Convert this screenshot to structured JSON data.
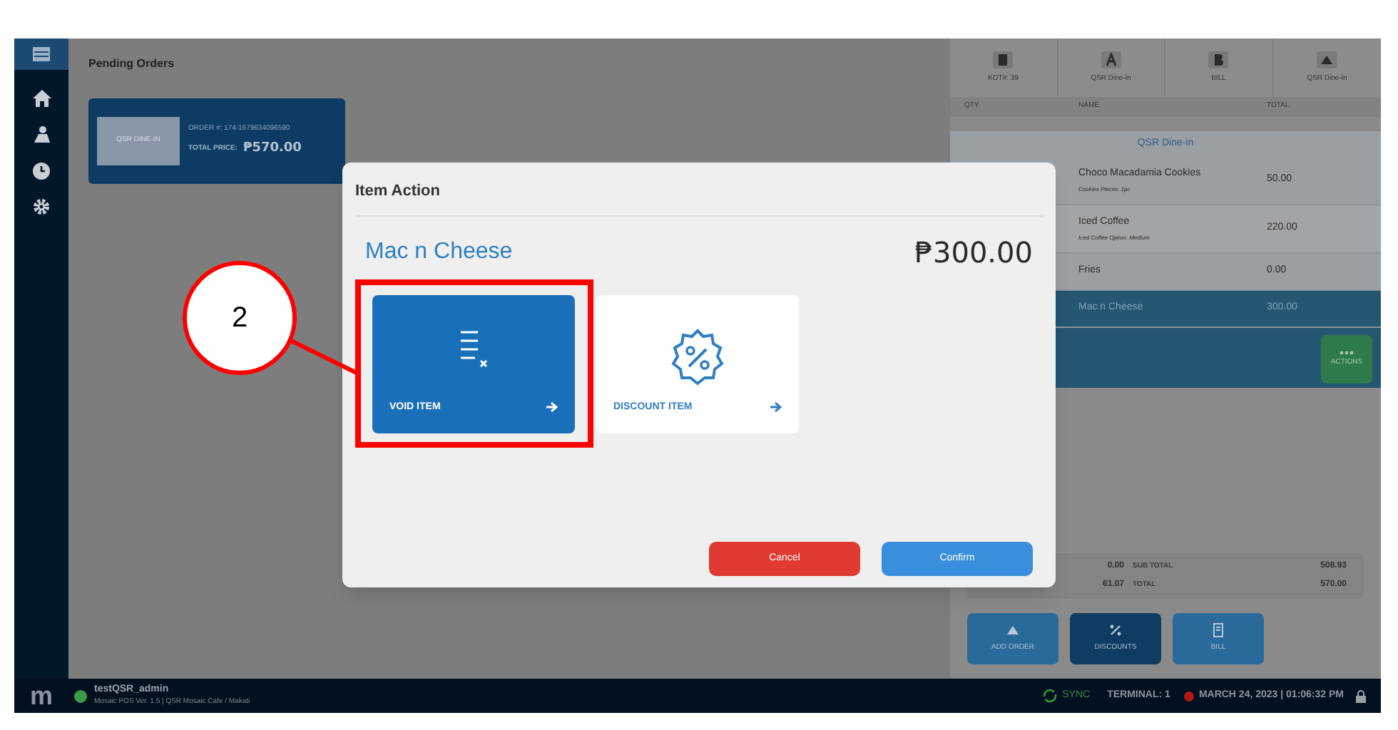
{
  "pending_orders": {
    "title": "Pending Orders",
    "orders": [
      {
        "type": "QSR DINE-IN",
        "order_number": "ORDER #: 174-1679634096590",
        "total_label": "TOTAL PRICE:",
        "total": "₱570.00"
      }
    ]
  },
  "order_panel": {
    "tabs": [
      {
        "label": "KOT#: 39",
        "kind": "receipt"
      },
      {
        "label": "QSR Dine-in",
        "kind": "letter-a"
      },
      {
        "label": "BILL",
        "kind": "letter-b"
      },
      {
        "label": "QSR Dine-in",
        "kind": "tray"
      }
    ],
    "columns": [
      "QTY",
      "NAME",
      "TOTAL"
    ],
    "group": "QSR Dine-in",
    "items": [
      {
        "name": "Choco Macadamia Cookies",
        "detail": "Cookies Pieces: 1pc",
        "total": "50.00",
        "selected": false
      },
      {
        "name": "Iced Coffee",
        "detail": "Iced Coffee Option: Medium",
        "total": "220.00",
        "selected": false
      },
      {
        "name": "Fries",
        "total": "0.00",
        "selected": false
      },
      {
        "name": "Mac n Cheese",
        "total": "300.00",
        "selected": true
      }
    ],
    "actions_button": "ACTIONS",
    "summary": [
      {
        "value": "0.00",
        "label": "SUB TOTAL",
        "amount": "508.93"
      },
      {
        "value": "61.07",
        "label": "TOTAL",
        "amount": "570.00"
      }
    ],
    "buttons": [
      {
        "label": "ADD ORDER",
        "kind": "add",
        "selected": false
      },
      {
        "label": "DISCOUNTS",
        "kind": "discount",
        "selected": true
      },
      {
        "label": "BILL",
        "kind": "bill",
        "selected": false
      }
    ]
  },
  "dialog": {
    "title": "Item Action",
    "item_name": "Mac n Cheese",
    "price": "₱300.00",
    "options": [
      {
        "label": "VOID ITEM",
        "kind": "void",
        "selected": true
      },
      {
        "label": "DISCOUNT ITEM",
        "kind": "discount",
        "selected": false
      }
    ],
    "buttons": [
      {
        "label": "Cancel",
        "kind": "cancel"
      },
      {
        "label": "Confirm",
        "kind": "confirm"
      }
    ]
  },
  "annotation": {
    "step": "2"
  },
  "status_bar": {
    "logo": "m",
    "user": "testQSR_admin",
    "online": true,
    "version": "Mosaic POS Ver. 1.5 | QSR Mosaic Cafe / Makati",
    "sync": "SYNC",
    "terminal": "TERMINAL: 1",
    "datetime": "MARCH 24, 2023 | 01:06:32 PM"
  }
}
